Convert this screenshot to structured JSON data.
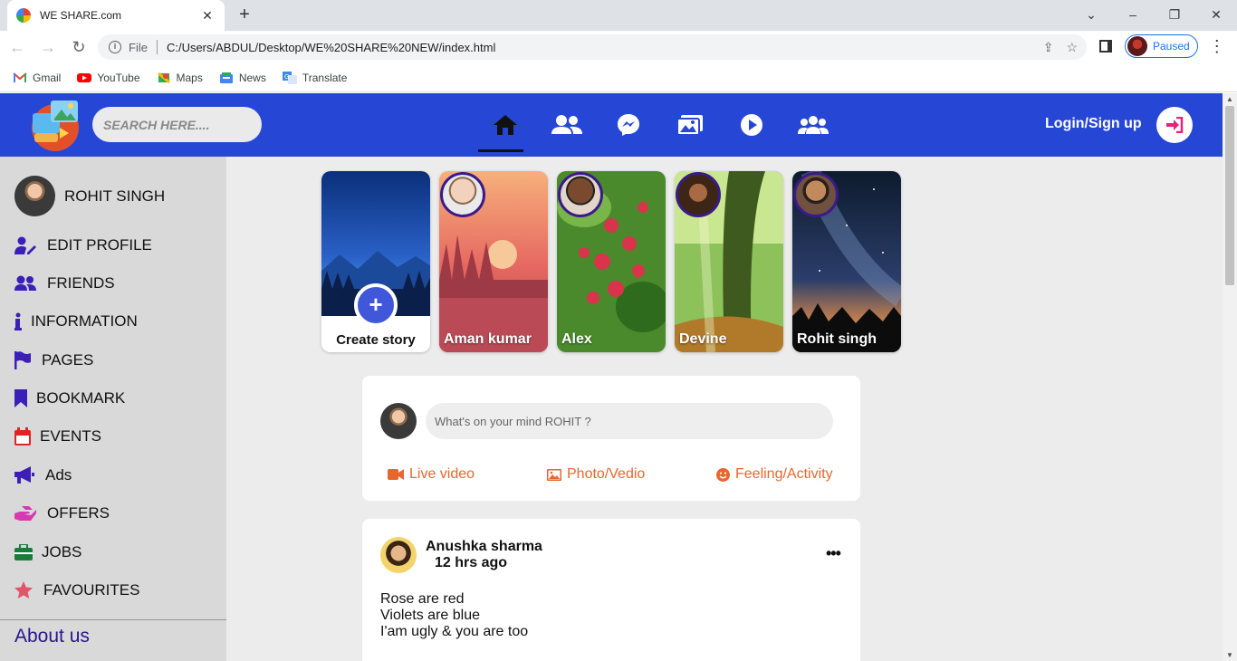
{
  "browser": {
    "tab_title": "WE SHARE.com",
    "address": {
      "scheme_label": "File",
      "url": "C:/Users/ABDUL/Desktop/WE%20SHARE%20NEW/index.html"
    },
    "profile_status": "Paused",
    "bookmarks": [
      {
        "label": "Gmail",
        "icon": "gmail-icon",
        "color": "#ea4335"
      },
      {
        "label": "YouTube",
        "icon": "youtube-icon",
        "color": "#ff0000"
      },
      {
        "label": "Maps",
        "icon": "maps-icon",
        "color": "#34a853"
      },
      {
        "label": "News",
        "icon": "news-icon",
        "color": "#4285f4"
      },
      {
        "label": "Translate",
        "icon": "translate-icon",
        "color": "#4285f4"
      }
    ]
  },
  "header": {
    "search_placeholder": "SEARCH HERE....",
    "nav": [
      "home-icon",
      "friends-icon",
      "messenger-icon",
      "photos-icon",
      "video-play-icon",
      "groups-icon"
    ],
    "login_label": "Login/Sign up",
    "brand_color": "#2647d6"
  },
  "sidebar": {
    "user_name": "ROHIT SINGH",
    "items": [
      {
        "label": "EDIT PROFILE",
        "icon": "user-edit-icon",
        "color": "#3b1fb8"
      },
      {
        "label": "FRIENDS",
        "icon": "friends-icon",
        "color": "#3b1fb8"
      },
      {
        "label": "INFORMATION",
        "icon": "info-icon",
        "color": "#3b1fb8"
      },
      {
        "label": "PAGES",
        "icon": "flag-icon",
        "color": "#3b1fb8"
      },
      {
        "label": "BOOKMARK",
        "icon": "bookmark-icon",
        "color": "#3b1fb8"
      },
      {
        "label": "EVENTS",
        "icon": "calendar-icon",
        "color": "#e02424"
      },
      {
        "label": "Ads",
        "icon": "megaphone-icon",
        "color": "#3b1fb8"
      },
      {
        "label": "OFFERS",
        "icon": "hand-offer-icon",
        "color": "#d63ab0"
      },
      {
        "label": "JOBS",
        "icon": "briefcase-icon",
        "color": "#1d7a3a"
      },
      {
        "label": "FAVOURITES",
        "icon": "star-icon",
        "color": "#e0556a"
      }
    ],
    "about_label": "About us"
  },
  "stories": [
    {
      "name": "Create story",
      "type": "create"
    },
    {
      "name": "Aman kumar"
    },
    {
      "name": "Alex"
    },
    {
      "name": "Devine"
    },
    {
      "name": "Rohit singh"
    }
  ],
  "composer": {
    "placeholder": "What's on your mind ROHIT ?",
    "actions": [
      {
        "label": "Live video",
        "icon": "video-camera-icon"
      },
      {
        "label": "Photo/Vedio",
        "icon": "image-icon"
      },
      {
        "label": "Feeling/Activity",
        "icon": "smile-icon"
      }
    ],
    "action_color": "#e8662d"
  },
  "post": {
    "author": "Anushka sharma",
    "time": "12 hrs ago",
    "lines": [
      "Rose are red",
      "Violets are blue",
      "I'am ugly & you are too"
    ]
  }
}
